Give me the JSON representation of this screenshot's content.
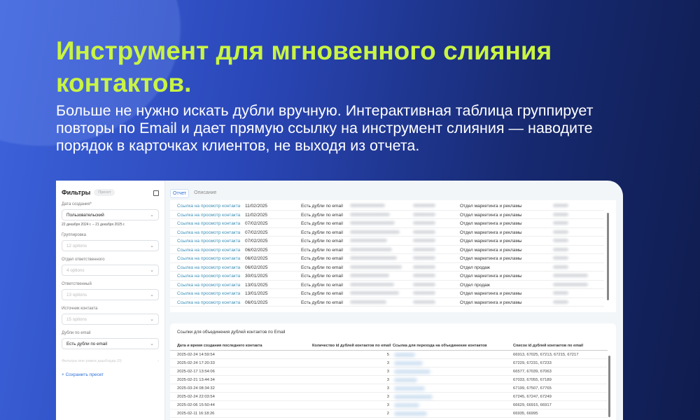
{
  "headline": "Инструмент для мгновенного слияния контактов.",
  "lead": "Больше не нужно искать дубли вручную. Интерактивная таблица группирует повторы по Email и дает прямую ссылку на инструмент слияния — наводите порядок в карточках клиентов, не выходя из отчета.",
  "filters": {
    "title": "Фильтры",
    "preset_badge": "Пресет",
    "date_label": "Дата создания*",
    "date_value": "Пользовательский",
    "date_range": "22 декабря 2024 г. – 21 декабря 2025 г.",
    "grouping_label": "Группировка",
    "grouping_value": "12 options",
    "dept_label": "Отдел ответственного",
    "dept_value": "4 options",
    "owner_label": "Ответственный",
    "owner_value": "13 options",
    "source_label": "Источник контакта",
    "source_value": "15 options",
    "dupes_label": "Дубли по email",
    "dupes_value": "Есть дубли по email",
    "outside": "Фильтры вне рамок дашборда (0)",
    "save": "+ Сохранить пресет"
  },
  "tabs": {
    "report": "Отчет",
    "description": "Описание"
  },
  "contacts": {
    "link_text": "Ссылка на просмотр контакта",
    "rows": [
      {
        "date": "11/02/2025",
        "status": "Есть дубли по email",
        "dept": "Отдел маркетинга и рекламы"
      },
      {
        "date": "11/02/2025",
        "status": "Есть дубли по email",
        "dept": "Отдел маркетинга и рекламы"
      },
      {
        "date": "07/02/2025",
        "status": "Есть дубли по email",
        "dept": "Отдел маркетинга и рекламы"
      },
      {
        "date": "07/02/2025",
        "status": "Есть дубли по email",
        "dept": "Отдел маркетинга и рекламы"
      },
      {
        "date": "07/02/2025",
        "status": "Есть дубли по email",
        "dept": "Отдел маркетинга и рекламы"
      },
      {
        "date": "06/02/2025",
        "status": "Есть дубли по email",
        "dept": "Отдел маркетинга и рекламы"
      },
      {
        "date": "06/02/2025",
        "status": "Есть дубли по email",
        "dept": "Отдел маркетинга и рекламы"
      },
      {
        "date": "06/02/2025",
        "status": "Есть дубли по email",
        "dept": "Отдел продаж"
      },
      {
        "date": "30/01/2025",
        "status": "Есть дубли по email",
        "dept": "Отдел маркетинга и рекламы"
      },
      {
        "date": "13/01/2025",
        "status": "Есть дубли по email",
        "dept": "Отдел продаж"
      },
      {
        "date": "13/01/2025",
        "status": "Есть дубли по email",
        "dept": "Отдел маркетинга и рекламы"
      },
      {
        "date": "06/01/2025",
        "status": "Есть дубли по email",
        "dept": "Отдел маркетинга и рекламы"
      }
    ]
  },
  "merge": {
    "title": "Ссылки для объединения дублей контактов по Email",
    "headers": [
      "Дата и время создания последнего контакта",
      "Количество id дублей контактов по email",
      "Ссылка для перехода на объединение контактов",
      "Список id дублей контактов по email"
    ],
    "rows": [
      {
        "dt": "2025-02-24 14:59:54",
        "count": "5",
        "ids": "66913, 67025, 67213, 67215, 67217"
      },
      {
        "dt": "2025-02-24 17:20:33",
        "count": "3",
        "ids": "67229, 67231, 67233"
      },
      {
        "dt": "2025-02-17 13:54:06",
        "count": "3",
        "ids": "66577, 67039, 67063"
      },
      {
        "dt": "2025-02-21 13:44:34",
        "count": "3",
        "ids": "67033, 67055, 67189"
      },
      {
        "dt": "2025-03-24 08:34:32",
        "count": "3",
        "ids": "67199, 67507, 67765"
      },
      {
        "dt": "2025-02-24 22:03:54",
        "count": "3",
        "ids": "67245, 67247, 67249"
      },
      {
        "dt": "2025-02-06 15:50:44",
        "count": "3",
        "ids": "66629, 66915, 66917"
      },
      {
        "dt": "2025-02-11 16:18:26",
        "count": "2",
        "ids": "66935, 66995"
      }
    ]
  }
}
